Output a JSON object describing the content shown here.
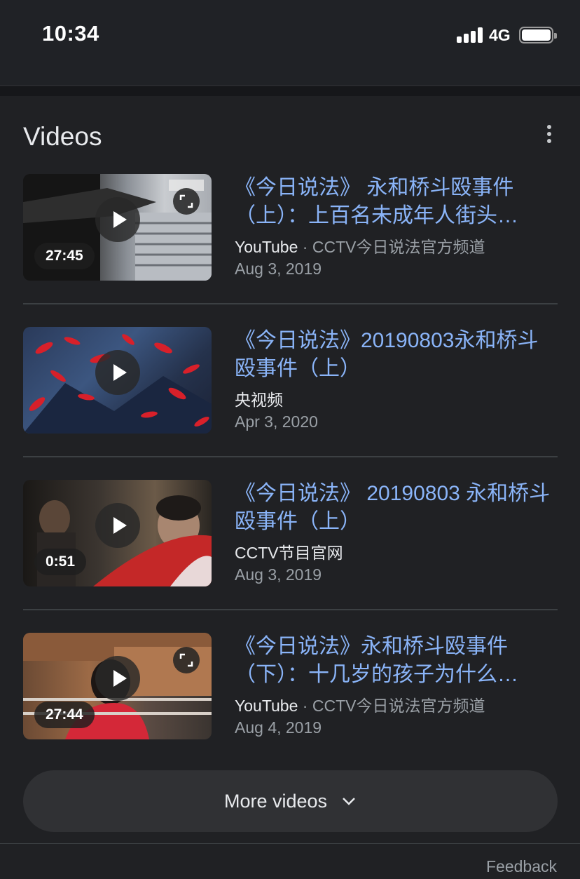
{
  "status_bar": {
    "time": "10:34",
    "network": "4G"
  },
  "section": {
    "title": "Videos"
  },
  "videos": [
    {
      "title": "《今日说法》 永和桥斗殴事件（上）：上百名未成年人街头…",
      "source": "YouTube",
      "separator": " · ",
      "channel": "CCTV今日说法官方频道",
      "date": "Aug 3, 2019",
      "duration": "27:45",
      "has_expand": true
    },
    {
      "title": "《今日说法》20190803永和桥斗殴事件（上）",
      "source": "央视频",
      "separator": "",
      "channel": "",
      "date": "Apr 3, 2020",
      "duration": "",
      "has_expand": false
    },
    {
      "title": "《今日说法》 20190803 永和桥斗殴事件（上）",
      "source": "CCTV节目官网",
      "separator": "",
      "channel": "",
      "date": "Aug 3, 2019",
      "duration": "0:51",
      "has_expand": false
    },
    {
      "title": "《今日说法》永和桥斗殴事件（下）：十几岁的孩子为什么…",
      "source": "YouTube",
      "separator": " · ",
      "channel": "CCTV今日说法官方频道",
      "date": "Aug 4, 2019",
      "duration": "27:44",
      "has_expand": true
    }
  ],
  "more_button": {
    "label": "More videos"
  },
  "footer": {
    "feedback": "Feedback"
  },
  "icons": {
    "menu": "more-vert-icon",
    "play": "play-icon",
    "expand": "expand-icon",
    "chevron": "chevron-down-icon"
  },
  "colors": {
    "background": "#202124",
    "title_link": "#8ab4f8",
    "secondary_text": "#9aa0a6"
  }
}
